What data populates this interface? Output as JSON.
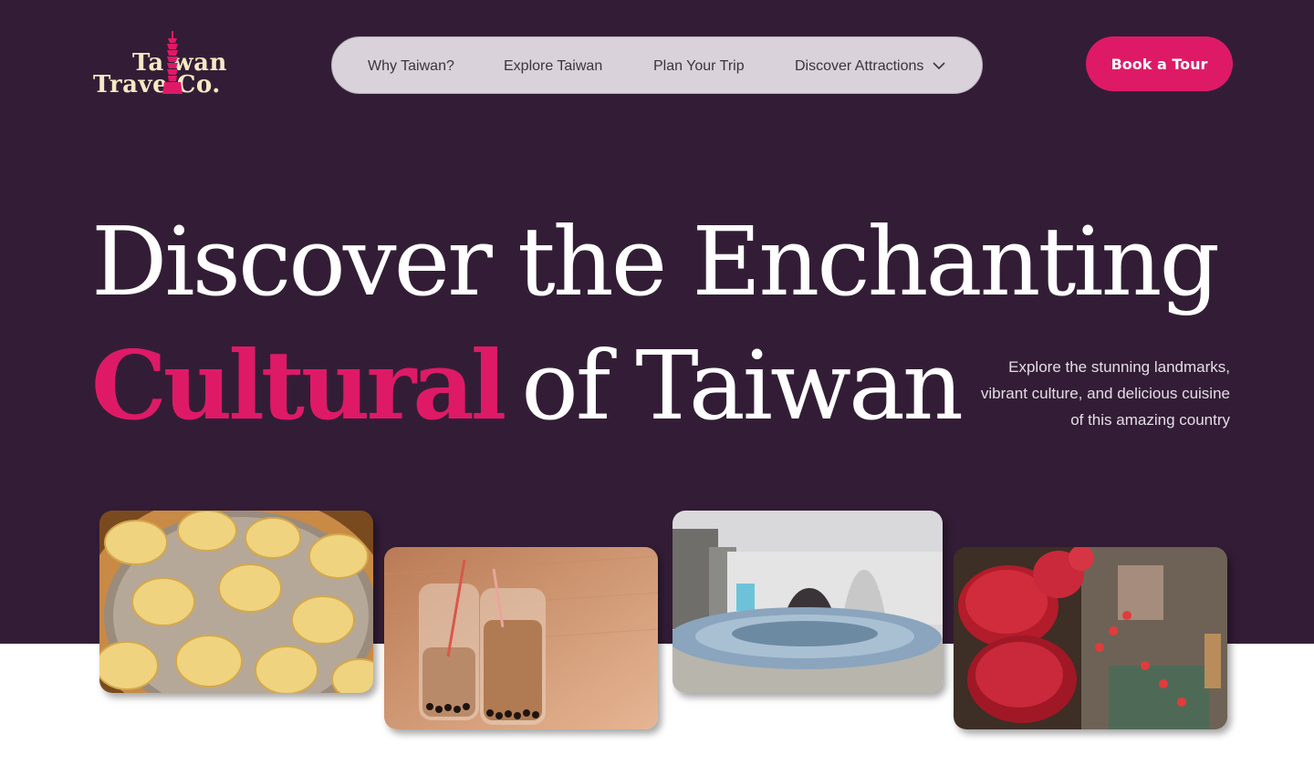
{
  "brand": {
    "line1": "Ta  wan",
    "line2": "Trave  Co.",
    "logo_icon": "taipei-101-tower-icon",
    "colors": {
      "cream": "#f6e9c3",
      "pink": "#de1a67"
    }
  },
  "nav": {
    "items": [
      {
        "label": "Why Taiwan?"
      },
      {
        "label": "Explore Taiwan"
      },
      {
        "label": "Plan Your Trip"
      },
      {
        "label": "Discover Attractions",
        "icon": "chevron-down-icon"
      }
    ]
  },
  "cta": {
    "label": "Book a Tour"
  },
  "hero": {
    "line1": "Discover the Enchanting",
    "accent": "Cultural",
    "line2_rest": "of Taiwan",
    "subtitle": "Explore the stunning landmarks, vibrant culture, and delicious cuisine of this amazing country"
  },
  "gallery": [
    {
      "subject": "dumplings"
    },
    {
      "subject": "bubble-tea"
    },
    {
      "subject": "opera-house"
    },
    {
      "subject": "lanterns"
    }
  ],
  "theme": {
    "background": "#331d36",
    "accent": "#de1a67",
    "nav_bg": "#d9d2da"
  }
}
